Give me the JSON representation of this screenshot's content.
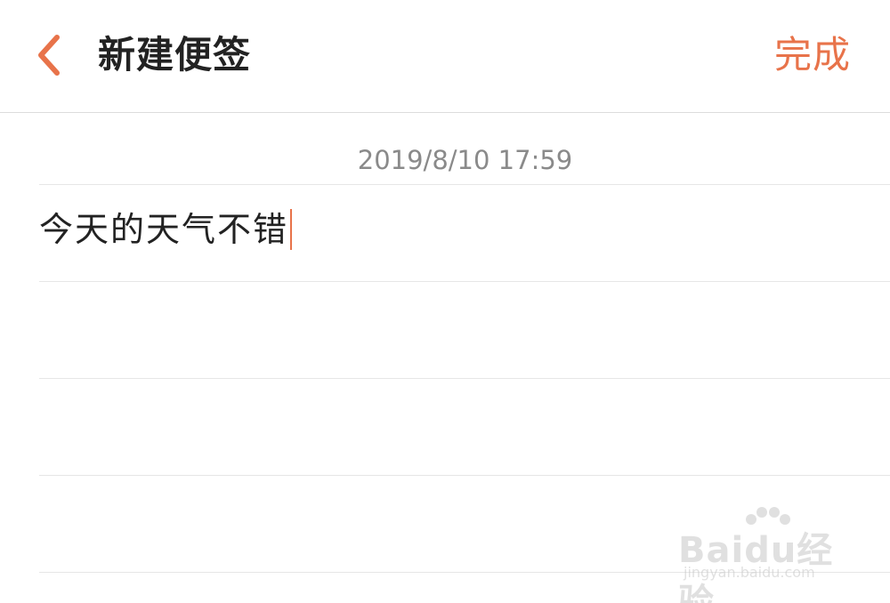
{
  "header": {
    "title": "新建便签",
    "done_label": "完成",
    "back_icon": "chevron-left-icon"
  },
  "note": {
    "timestamp": "2019/8/10 17:59",
    "content": "今天的天气不错"
  },
  "watermark": {
    "logo_text": "Baidu经验",
    "sub_text": "jingyan.baidu.com"
  },
  "colors": {
    "accent": "#e8734a",
    "text": "#222222",
    "muted": "#8a8a8a",
    "rule": "#e6e6e6"
  }
}
